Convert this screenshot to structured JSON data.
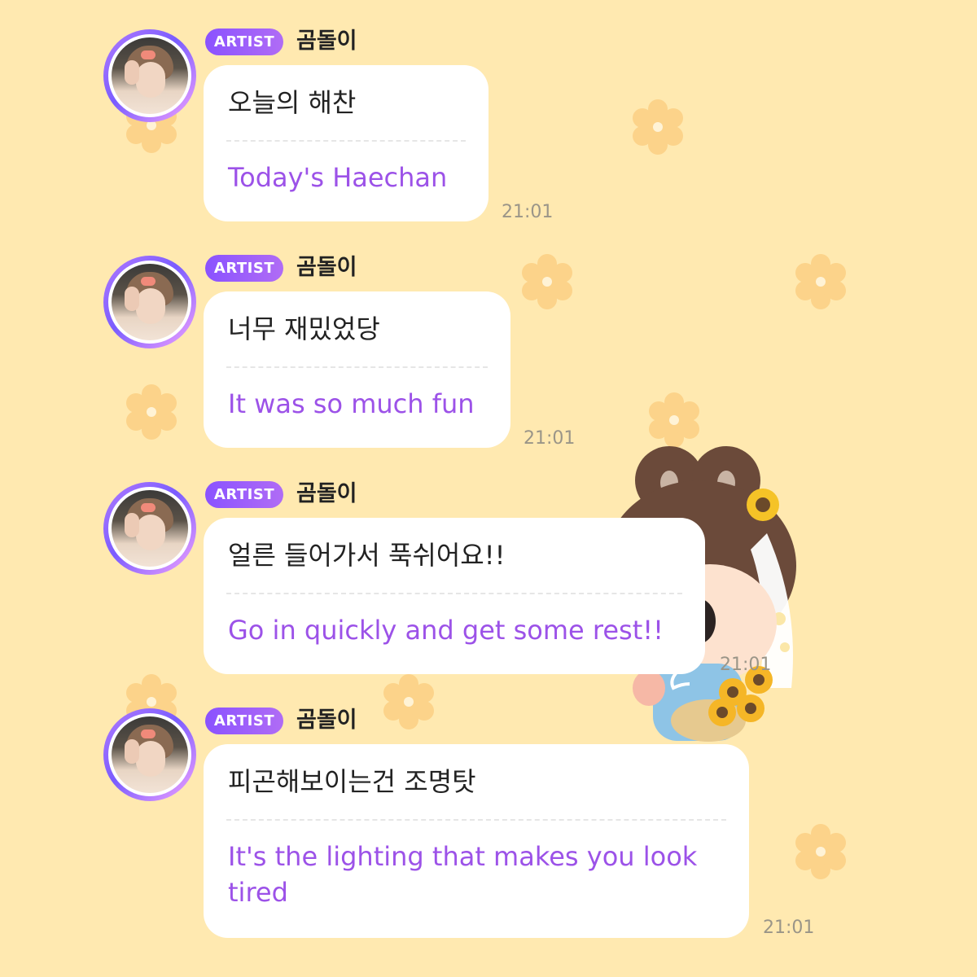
{
  "colors": {
    "background": "#ffe9b0",
    "flower": "#fcd38a",
    "badge_start": "#8a52ff",
    "badge_end": "#b06cf5",
    "translation_text": "#9c52e8",
    "timestamp": "#9a9588"
  },
  "messages": [
    {
      "badge": "ARTIST",
      "sender": "곰돌이",
      "original": "오늘의 해찬",
      "translation": "Today's Haechan",
      "time": "21:01"
    },
    {
      "badge": "ARTIST",
      "sender": "곰돌이",
      "original": "너무 재밌었당",
      "translation": "It was so much fun",
      "time": "21:01"
    },
    {
      "badge": "ARTIST",
      "sender": "곰돌이",
      "original": "얼른 들어가서 푹쉬어요!!",
      "translation": "Go in quickly and get some rest!!",
      "time": "21:01"
    },
    {
      "badge": "ARTIST",
      "sender": "곰돌이",
      "original": "피곤해보이는건 조명탓",
      "translation": "It's the lighting that makes you look tired",
      "time": "21:01"
    }
  ],
  "icons": {
    "background_pattern": "flower-icon",
    "sticker": "bear-character-sticker"
  }
}
